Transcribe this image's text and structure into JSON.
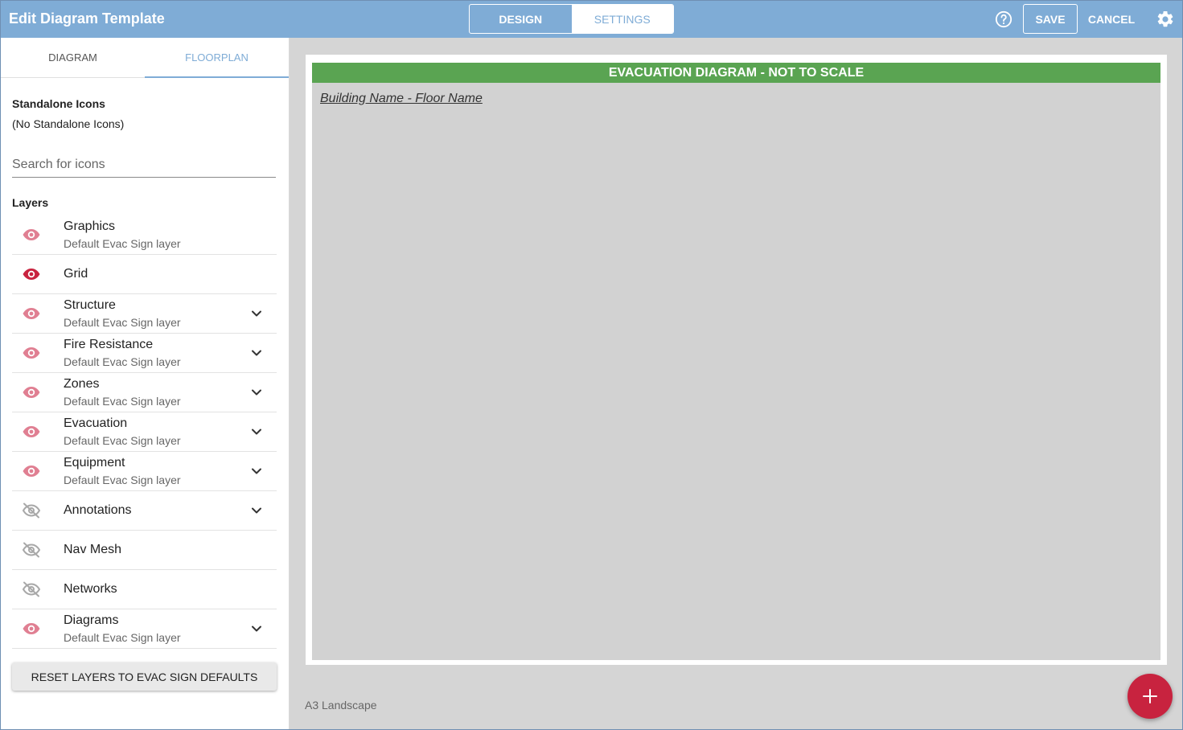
{
  "header": {
    "title": "Edit Diagram Template",
    "modes": [
      {
        "label": "DESIGN",
        "active": true
      },
      {
        "label": "SETTINGS",
        "active": false
      }
    ],
    "save_label": "SAVE",
    "cancel_label": "CANCEL",
    "icons": [
      "help-circle-icon",
      "gear-icon"
    ]
  },
  "sidebar": {
    "tabs": [
      {
        "label": "DIAGRAM",
        "active": false
      },
      {
        "label": "FLOORPLAN",
        "active": true
      }
    ],
    "standalone_heading": "Standalone Icons",
    "standalone_empty": "(No Standalone Icons)",
    "search_placeholder": "Search for icons",
    "layers_heading": "Layers",
    "layers": [
      {
        "name": "Graphics",
        "sub": "Default Evac Sign layer",
        "visibility": "faded",
        "expandable": false
      },
      {
        "name": "Grid",
        "sub": "",
        "visibility": "visible",
        "expandable": false
      },
      {
        "name": "Structure",
        "sub": "Default Evac Sign layer",
        "visibility": "faded",
        "expandable": true
      },
      {
        "name": "Fire Resistance",
        "sub": "Default Evac Sign layer",
        "visibility": "faded",
        "expandable": true
      },
      {
        "name": "Zones",
        "sub": "Default Evac Sign layer",
        "visibility": "faded",
        "expandable": true
      },
      {
        "name": "Evacuation",
        "sub": "Default Evac Sign layer",
        "visibility": "faded",
        "expandable": true
      },
      {
        "name": "Equipment",
        "sub": "Default Evac Sign layer",
        "visibility": "faded",
        "expandable": true
      },
      {
        "name": "Annotations",
        "sub": "",
        "visibility": "hidden",
        "expandable": true
      },
      {
        "name": "Nav Mesh",
        "sub": "",
        "visibility": "hidden",
        "expandable": false
      },
      {
        "name": "Networks",
        "sub": "",
        "visibility": "hidden",
        "expandable": false
      },
      {
        "name": "Diagrams",
        "sub": "Default Evac Sign layer",
        "visibility": "faded",
        "expandable": true
      }
    ],
    "reset_label": "RESET LAYERS TO EVAC SIGN DEFAULTS"
  },
  "main": {
    "banner": "EVACUATION DIAGRAM - NOT TO SCALE",
    "building_floor": "Building Name - Floor Name",
    "paper_size": "A3 Landscape",
    "fab_icon": "plus-icon"
  },
  "colors": {
    "header": "#7facd6",
    "banner": "#5aa452",
    "eye_visible": "#c8233f",
    "eye_faded": "#e07f92",
    "eye_hidden": "#a8a8a8",
    "fab": "#c8233f"
  }
}
